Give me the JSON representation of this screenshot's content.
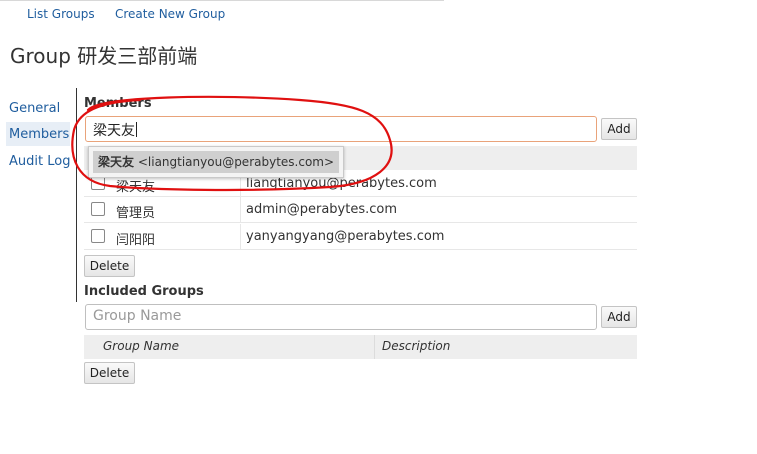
{
  "top_nav": {
    "list_groups": "List Groups",
    "create_group": "Create New Group"
  },
  "page_title": "Group 研发三部前端",
  "side_nav": {
    "items": [
      "General",
      "Members",
      "Audit Log"
    ],
    "active": "Members"
  },
  "members": {
    "section_title": "Members",
    "input_value": "梁天友",
    "add_label": "Add",
    "autocomplete": {
      "name": "梁天友",
      "email": "<liangtianyou@perabytes.com>"
    },
    "rows": [
      {
        "name": "梁天友",
        "email": "liangtianyou@perabytes.com"
      },
      {
        "name": "管理员",
        "email": "admin@perabytes.com"
      },
      {
        "name": "闫阳阳",
        "email": "yanyangyang@perabytes.com"
      }
    ],
    "delete_label": "Delete"
  },
  "included_groups": {
    "section_title": "Included Groups",
    "input_placeholder": "Group Name",
    "add_label": "Add",
    "columns": [
      "Group Name",
      "Description"
    ],
    "delete_label": "Delete"
  },
  "colors": {
    "link": "#1f5d9e",
    "annotation": "#e01010",
    "focus_border": "#e9a37a"
  }
}
